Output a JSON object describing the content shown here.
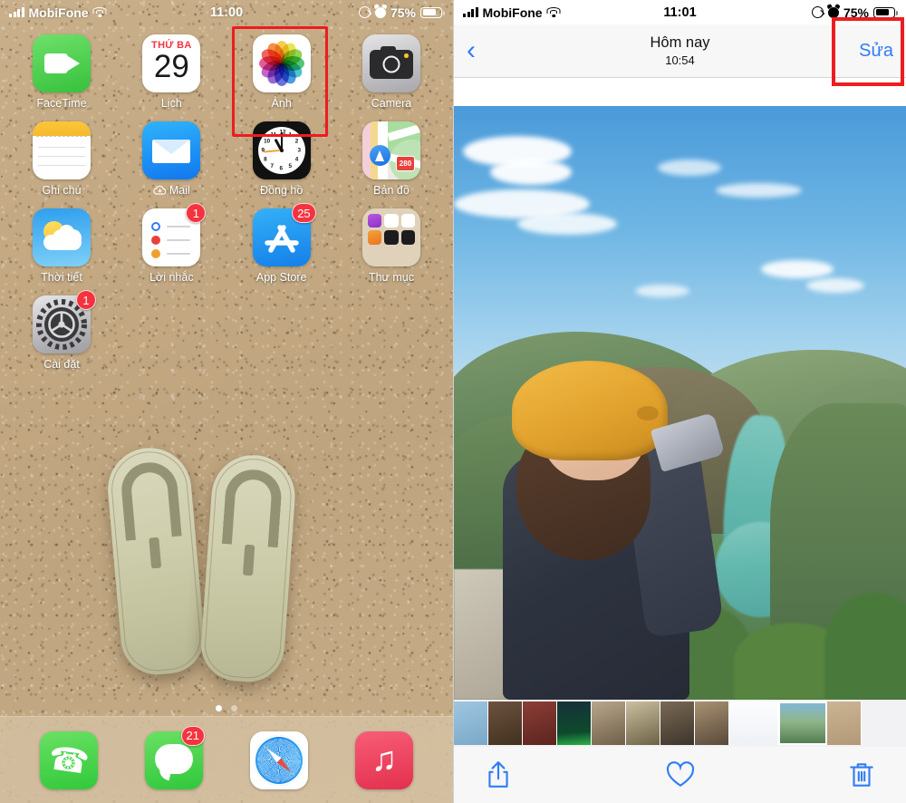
{
  "home": {
    "status": {
      "carrier": "MobiFone",
      "time": "11:00",
      "battery_percent": "75%",
      "signal_icon": "cellular-bars-icon",
      "wifi_icon": "wifi-icon",
      "rotation_lock_icon": "rotation-lock-icon",
      "alarm_icon": "alarm-clock-icon",
      "battery_icon": "battery-icon"
    },
    "rows": [
      [
        {
          "label": "FaceTime",
          "icon": "facetime-icon",
          "badge": null
        },
        {
          "label": "Lịch",
          "icon": "calendar-icon",
          "badge": null,
          "weekday": "THỨ BA",
          "day": "29"
        },
        {
          "label": "Ảnh",
          "icon": "photos-icon",
          "badge": null,
          "selected": true
        },
        {
          "label": "Camera",
          "icon": "camera-icon",
          "badge": null
        }
      ],
      [
        {
          "label": "Ghi chú",
          "icon": "notes-icon",
          "badge": null
        },
        {
          "label": "Mail",
          "icon": "mail-icon",
          "badge": null,
          "cloud": true
        },
        {
          "label": "Đồng hồ",
          "icon": "clock-icon",
          "badge": null
        },
        {
          "label": "Bản đồ",
          "icon": "maps-icon",
          "badge": null,
          "route": "280"
        }
      ],
      [
        {
          "label": "Thời tiết",
          "icon": "weather-icon",
          "badge": null
        },
        {
          "label": "Lời nhắc",
          "icon": "reminders-icon",
          "badge": "1"
        },
        {
          "label": "App Store",
          "icon": "app-store-icon",
          "badge": "25"
        },
        {
          "label": "Thư mục",
          "icon": "folder-icon",
          "badge": null
        }
      ],
      [
        {
          "label": "Cài đặt",
          "icon": "settings-icon",
          "badge": "1"
        }
      ]
    ],
    "page_dots": {
      "count": 2,
      "active": 1
    },
    "dock": [
      {
        "label": "Phone",
        "icon": "phone-icon",
        "badge": null
      },
      {
        "label": "Messages",
        "icon": "messages-icon",
        "badge": "21"
      },
      {
        "label": "Safari",
        "icon": "safari-icon",
        "badge": null
      },
      {
        "label": "Music",
        "icon": "music-icon",
        "badge": null
      }
    ],
    "highlight_color": "#ee1c20"
  },
  "photos": {
    "status": {
      "carrier": "MobiFone",
      "time": "11:01",
      "battery_percent": "75%"
    },
    "nav": {
      "back_icon": "chevron-left-icon",
      "title": "Hôm nay",
      "subtitle": "10:54",
      "edit_label": "Sửa"
    },
    "toolbar": [
      {
        "name": "share-icon",
        "label": "Share"
      },
      {
        "name": "heart-icon",
        "label": "Favorite"
      },
      {
        "name": "trash-icon",
        "label": "Delete"
      }
    ],
    "thumbnails_count": 11,
    "selected_thumbnail_index": 9,
    "accent_color": "#2f7df6",
    "highlight_color": "#ee1c20"
  }
}
